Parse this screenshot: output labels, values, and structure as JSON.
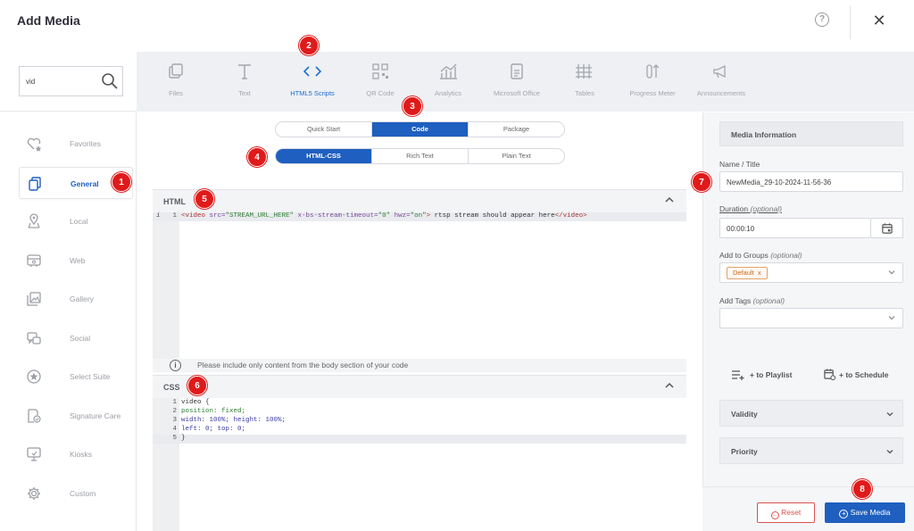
{
  "window": {
    "title": "Add Media",
    "help_label": "?",
    "close_label": "✕"
  },
  "search": {
    "value": "vid"
  },
  "categories": [
    {
      "label": "Files",
      "icon": "files-icon"
    },
    {
      "label": "Text",
      "icon": "text-icon"
    },
    {
      "label": "HTML5 Scripts",
      "icon": "code-icon",
      "active": true
    },
    {
      "label": "QR Code",
      "icon": "qr-code-icon"
    },
    {
      "label": "Analytics",
      "icon": "analytics-icon"
    },
    {
      "label": "Microsoft Office",
      "icon": "office-icon"
    },
    {
      "label": "Tables",
      "icon": "tables-icon"
    },
    {
      "label": "Progress Meter",
      "icon": "progress-meter-icon"
    },
    {
      "label": "Announcements",
      "icon": "megaphone-icon"
    }
  ],
  "sidebar": {
    "items": [
      {
        "label": "Favorites",
        "icon": "heart-star-icon"
      },
      {
        "label": "General",
        "icon": "copy-icon",
        "active": true
      },
      {
        "label": "Local",
        "icon": "location-icon"
      },
      {
        "label": "Web",
        "icon": "web-icon"
      },
      {
        "label": "Gallery",
        "icon": "gallery-icon"
      },
      {
        "label": "Social",
        "icon": "social-icon"
      },
      {
        "label": "Select Suite",
        "icon": "star-circle-icon"
      },
      {
        "label": "Signature Care",
        "icon": "signature-care-icon"
      },
      {
        "label": "Kiosks",
        "icon": "kiosk-icon"
      },
      {
        "label": "Custom",
        "icon": "gear-icon"
      }
    ]
  },
  "mode_tabs": [
    "Quick Start",
    "Code",
    "Package"
  ],
  "mode_selected": "Code",
  "format_tabs": [
    "HTML-CSS",
    "Rich Text",
    "Plain Text"
  ],
  "format_selected": "HTML-CSS",
  "html_panel": {
    "title": "HTML",
    "lines": [
      {
        "num": "1",
        "marker": "i"
      }
    ],
    "code_parts": {
      "open": "<video ",
      "attr1": "src=",
      "val1": "\"STREAM_URL_HERE\"",
      "attr2": " x-bs-stream-timeout=",
      "val2": "\"0\"",
      "attr3": " hwz=",
      "val3": "\"on\"",
      "gt": ">",
      "text": " rtsp stream should appear here",
      "close": "</video>"
    },
    "notice": "Please include only content from the body section of your code",
    "notice_icon": "info-icon"
  },
  "css_panel": {
    "title": "CSS",
    "lines": [
      {
        "num": "1",
        "text": "video {"
      },
      {
        "num": "2",
        "text": "position: fixed;"
      },
      {
        "num": "3",
        "text": "width: 100%; height: 100%;"
      },
      {
        "num": "4",
        "text": "left: 0; top: 0;"
      },
      {
        "num": "5",
        "text": "}"
      }
    ]
  },
  "media_info": {
    "header": "Media Information",
    "name_label": "Name / Title",
    "name_value": "NewMedia_29-10-2024-11-56-36",
    "duration_label": "Duration",
    "duration_optional": "(optional)",
    "duration_value": "00:00:10",
    "groups_label": "Add to Groups",
    "groups_optional": "(optional)",
    "group_chip": "Default",
    "group_chip_remove": "x",
    "tags_label": "Add Tags",
    "tags_optional": "(optional)",
    "add_playlist": "+ to Playlist",
    "add_schedule": "+ to Schedule",
    "validity": "Validity",
    "priority": "Priority"
  },
  "footer": {
    "reset": "Reset",
    "save": "Save Media"
  },
  "badges": [
    "1",
    "2",
    "3",
    "4",
    "5",
    "6",
    "7",
    "8"
  ],
  "colors": {
    "primary": "#1f5fbf",
    "badge": "#e01a1a",
    "danger": "#d9534f",
    "chip": "#c8691e"
  }
}
